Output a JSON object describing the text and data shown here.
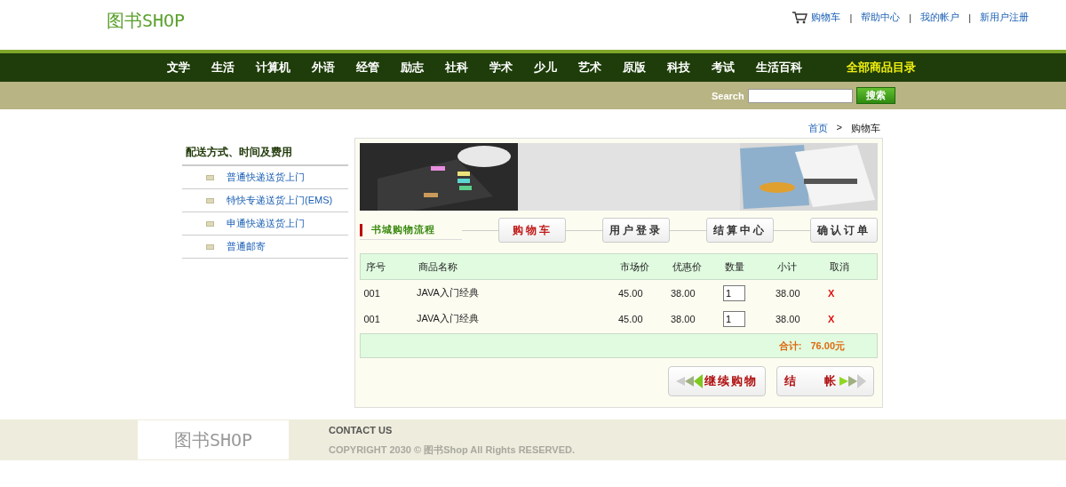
{
  "header": {
    "logo": "图书SHOP",
    "separator": "|",
    "links": [
      {
        "label": "购物车",
        "kind": "cart"
      },
      {
        "label": "帮助中心",
        "kind": "plain"
      },
      {
        "label": "我的帐户",
        "kind": "plain"
      },
      {
        "label": "新用户注册",
        "kind": "plain"
      }
    ]
  },
  "nav": {
    "items": [
      "文学",
      "生活",
      "计算机",
      "外语",
      "经管",
      "励志",
      "社科",
      "学术",
      "少儿",
      "艺术",
      "原版",
      "科技",
      "考试",
      "生活百科"
    ],
    "catalog": "全部商品目录"
  },
  "search": {
    "label": "Search",
    "button": "搜索"
  },
  "breadcrumb": {
    "home": "首页",
    "separator": ">",
    "current": "购物车"
  },
  "sidebar": {
    "title": "配送方式、时间及费用",
    "items": [
      "普通快递送货上门",
      "特快专递送货上门(EMS)",
      "申通快递送货上门",
      "普通邮寄"
    ]
  },
  "flow": {
    "title": "书城购物流程",
    "steps": [
      {
        "label": "购物车",
        "selected": true
      },
      {
        "label": "用户登录",
        "selected": false
      },
      {
        "label": "结算中心",
        "selected": false
      },
      {
        "label": "确认订单",
        "selected": false
      }
    ]
  },
  "cart": {
    "columns": [
      "序号",
      "商品名称",
      "市场价",
      "优惠价",
      "数量",
      "小计",
      "取消"
    ],
    "rows": [
      {
        "id": "001",
        "name": "JAVA入门经典",
        "market": "45.00",
        "price": "38.00",
        "qty": "1",
        "subtotal": "38.00",
        "remove": "X"
      },
      {
        "id": "001",
        "name": "JAVA入门经典",
        "market": "45.00",
        "price": "38.00",
        "qty": "1",
        "subtotal": "38.00",
        "remove": "X"
      }
    ],
    "total_label": "合计:",
    "total": "76.00元"
  },
  "buttons": [
    {
      "label": "继续购物",
      "kind": "back"
    },
    {
      "label": "结　　帐",
      "kind": "forward"
    }
  ],
  "footer": {
    "logo": "图书SHOP",
    "contact": "CONTACT US",
    "copyright": "COPYRIGHT 2030 © 图书Shop All Rights RESERVED."
  }
}
